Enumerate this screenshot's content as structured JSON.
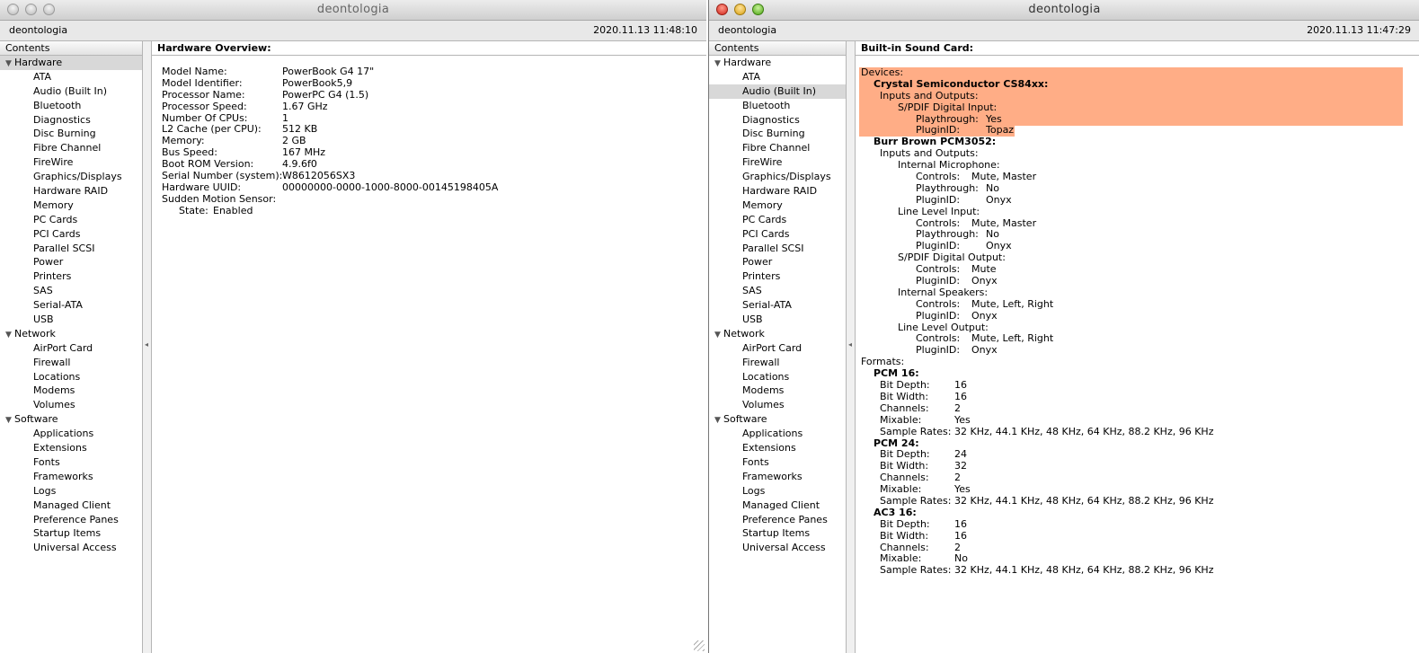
{
  "windows": [
    {
      "title": "deontologia",
      "machine": "deontologia",
      "timestamp": "2020.11.13 11:48:10",
      "contents_label": "Contents",
      "detail_title": "Hardware Overview:",
      "sections": [
        {
          "label": "Hardware",
          "items": [
            "ATA",
            "Audio (Built In)",
            "Bluetooth",
            "Diagnostics",
            "Disc Burning",
            "Fibre Channel",
            "FireWire",
            "Graphics/Displays",
            "Hardware RAID",
            "Memory",
            "PC Cards",
            "PCI Cards",
            "Parallel SCSI",
            "Power",
            "Printers",
            "SAS",
            "Serial-ATA",
            "USB"
          ]
        },
        {
          "label": "Network",
          "items": [
            "AirPort Card",
            "Firewall",
            "Locations",
            "Modems",
            "Volumes"
          ]
        },
        {
          "label": "Software",
          "items": [
            "Applications",
            "Extensions",
            "Fonts",
            "Frameworks",
            "Logs",
            "Managed Client",
            "Preference Panes",
            "Startup Items",
            "Universal Access"
          ]
        }
      ],
      "overview": [
        {
          "k": "Model Name:",
          "v": "PowerBook G4 17\""
        },
        {
          "k": "Model Identifier:",
          "v": "PowerBook5,9"
        },
        {
          "k": "Processor Name:",
          "v": "PowerPC G4 (1.5)"
        },
        {
          "k": "Processor Speed:",
          "v": "1.67 GHz"
        },
        {
          "k": "Number Of CPUs:",
          "v": "1"
        },
        {
          "k": "L2 Cache (per CPU):",
          "v": "512 KB"
        },
        {
          "k": "Memory:",
          "v": "2 GB"
        },
        {
          "k": "Bus Speed:",
          "v": "167 MHz"
        },
        {
          "k": "Boot ROM Version:",
          "v": "4.9.6f0"
        },
        {
          "k": "Serial Number (system):",
          "v": "W8612056SX3"
        },
        {
          "k": "Hardware UUID:",
          "v": "00000000-0000-1000-8000-00145198405A"
        },
        {
          "k": "Sudden Motion Sensor:",
          "v": ""
        },
        {
          "k": "State:",
          "v": "Enabled"
        }
      ]
    },
    {
      "title": "deontologia",
      "machine": "deontologia",
      "timestamp": "2020.11.13 11:47:29",
      "contents_label": "Contents",
      "selected_item": "Audio (Built In)",
      "detail_title": "Built-in Sound Card:",
      "sections": [
        {
          "label": "Hardware",
          "items": [
            "ATA",
            "Audio (Built In)",
            "Bluetooth",
            "Diagnostics",
            "Disc Burning",
            "Fibre Channel",
            "FireWire",
            "Graphics/Displays",
            "Hardware RAID",
            "Memory",
            "PC Cards",
            "PCI Cards",
            "Parallel SCSI",
            "Power",
            "Printers",
            "SAS",
            "Serial-ATA",
            "USB"
          ]
        },
        {
          "label": "Network",
          "items": [
            "AirPort Card",
            "Firewall",
            "Locations",
            "Modems",
            "Volumes"
          ]
        },
        {
          "label": "Software",
          "items": [
            "Applications",
            "Extensions",
            "Fonts",
            "Frameworks",
            "Logs",
            "Managed Client",
            "Preference Panes",
            "Startup Items",
            "Universal Access"
          ]
        }
      ],
      "sound_rows": [
        {
          "level": 0,
          "k": "Devices:",
          "v": ""
        },
        {
          "level": 1,
          "k": "Crystal Semiconductor CS84xx:",
          "v": "",
          "bold": true
        },
        {
          "level": 2,
          "k": "Inputs and Outputs:",
          "v": ""
        },
        {
          "level": 3,
          "k": "S/PDIF Digital Input:",
          "v": ""
        },
        {
          "level": 4,
          "k": "Playthrough:",
          "v": "Yes"
        },
        {
          "level": 4,
          "k": "PluginID:",
          "v": "Topaz"
        },
        {
          "level": 1,
          "k": "Burr Brown PCM3052:",
          "v": "",
          "bold": true
        },
        {
          "level": 2,
          "k": "Inputs and Outputs:",
          "v": ""
        },
        {
          "level": 3,
          "k": "Internal Microphone:",
          "v": ""
        },
        {
          "level": 4,
          "k": "Controls:",
          "v": "Mute, Master"
        },
        {
          "level": 4,
          "k": "Playthrough:",
          "v": "No"
        },
        {
          "level": 4,
          "k": "PluginID:",
          "v": "Onyx"
        },
        {
          "level": 3,
          "k": "Line Level Input:",
          "v": ""
        },
        {
          "level": 4,
          "k": "Controls:",
          "v": "Mute, Master"
        },
        {
          "level": 4,
          "k": "Playthrough:",
          "v": "No"
        },
        {
          "level": 4,
          "k": "PluginID:",
          "v": "Onyx"
        },
        {
          "level": 3,
          "k": "S/PDIF Digital Output:",
          "v": ""
        },
        {
          "level": 4,
          "k": "Controls:",
          "v": "Mute"
        },
        {
          "level": 4,
          "k": "PluginID:",
          "v": "Onyx"
        },
        {
          "level": 3,
          "k": "Internal Speakers:",
          "v": ""
        },
        {
          "level": 4,
          "k": "Controls:",
          "v": "Mute, Left, Right"
        },
        {
          "level": 4,
          "k": "PluginID:",
          "v": "Onyx"
        },
        {
          "level": 3,
          "k": "Line Level Output:",
          "v": ""
        },
        {
          "level": 4,
          "k": "Controls:",
          "v": "Mute, Left, Right"
        },
        {
          "level": 4,
          "k": "PluginID:",
          "v": "Onyx"
        },
        {
          "level": 0,
          "k": "Formats:",
          "v": ""
        },
        {
          "level": 1,
          "k": "PCM 16:",
          "v": "",
          "bold": true
        },
        {
          "level": 2,
          "k": "Bit Depth:",
          "v": "16"
        },
        {
          "level": 2,
          "k": "Bit Width:",
          "v": "16"
        },
        {
          "level": 2,
          "k": "Channels:",
          "v": "2"
        },
        {
          "level": 2,
          "k": "Mixable:",
          "v": "Yes"
        },
        {
          "level": 2,
          "k": "Sample Rates:",
          "v": "32 KHz, 44.1 KHz, 48 KHz, 64 KHz, 88.2 KHz, 96 KHz"
        },
        {
          "level": 1,
          "k": "PCM 24:",
          "v": "",
          "bold": true
        },
        {
          "level": 2,
          "k": "Bit Depth:",
          "v": "24"
        },
        {
          "level": 2,
          "k": "Bit Width:",
          "v": "32"
        },
        {
          "level": 2,
          "k": "Channels:",
          "v": "2"
        },
        {
          "level": 2,
          "k": "Mixable:",
          "v": "Yes"
        },
        {
          "level": 2,
          "k": "Sample Rates:",
          "v": "32 KHz, 44.1 KHz, 48 KHz, 64 KHz, 88.2 KHz, 96 KHz"
        },
        {
          "level": 1,
          "k": "AC3 16:",
          "v": "",
          "bold": true
        },
        {
          "level": 2,
          "k": "Bit Depth:",
          "v": "16"
        },
        {
          "level": 2,
          "k": "Bit Width:",
          "v": "16"
        },
        {
          "level": 2,
          "k": "Channels:",
          "v": "2"
        },
        {
          "level": 2,
          "k": "Mixable:",
          "v": "No"
        },
        {
          "level": 2,
          "k": "Sample Rates:",
          "v": "32 KHz, 44.1 KHz, 48 KHz, 64 KHz, 88.2 KHz, 96 KHz"
        }
      ],
      "highlight_color": "#ffad86"
    }
  ]
}
